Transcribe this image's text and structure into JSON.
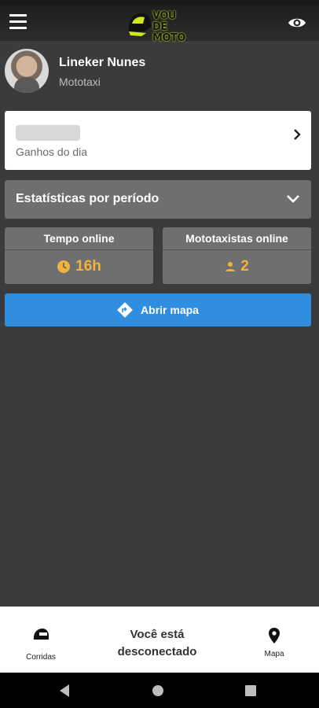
{
  "header": {
    "logo_text_line1": "VOU DE",
    "logo_text_line2": "MOTO",
    "menu_icon": "hamburger-menu-icon",
    "visibility_icon": "eye-icon"
  },
  "profile": {
    "name": "Lineker Nunes",
    "role": "Mototaxi"
  },
  "earnings": {
    "label": "Ganhos do dia"
  },
  "stats": {
    "label": "Estatísticas por período"
  },
  "online_time": {
    "title": "Tempo online",
    "value": "16h",
    "icon": "clock-icon"
  },
  "drivers_online": {
    "title": "Mototaxistas online",
    "value": "2",
    "icon": "person-icon"
  },
  "map_button": {
    "label": "Abrir mapa",
    "icon": "directions-icon"
  },
  "bottom_nav": {
    "rides_label": "Corridas",
    "status_text": "Você está desconectado",
    "map_label": "Mapa"
  },
  "colors": {
    "background": "#3a3b3c",
    "accent_blue": "#2f8ee0",
    "highlight_orange": "#f3b23b",
    "card_gray": "#6e6f70"
  }
}
